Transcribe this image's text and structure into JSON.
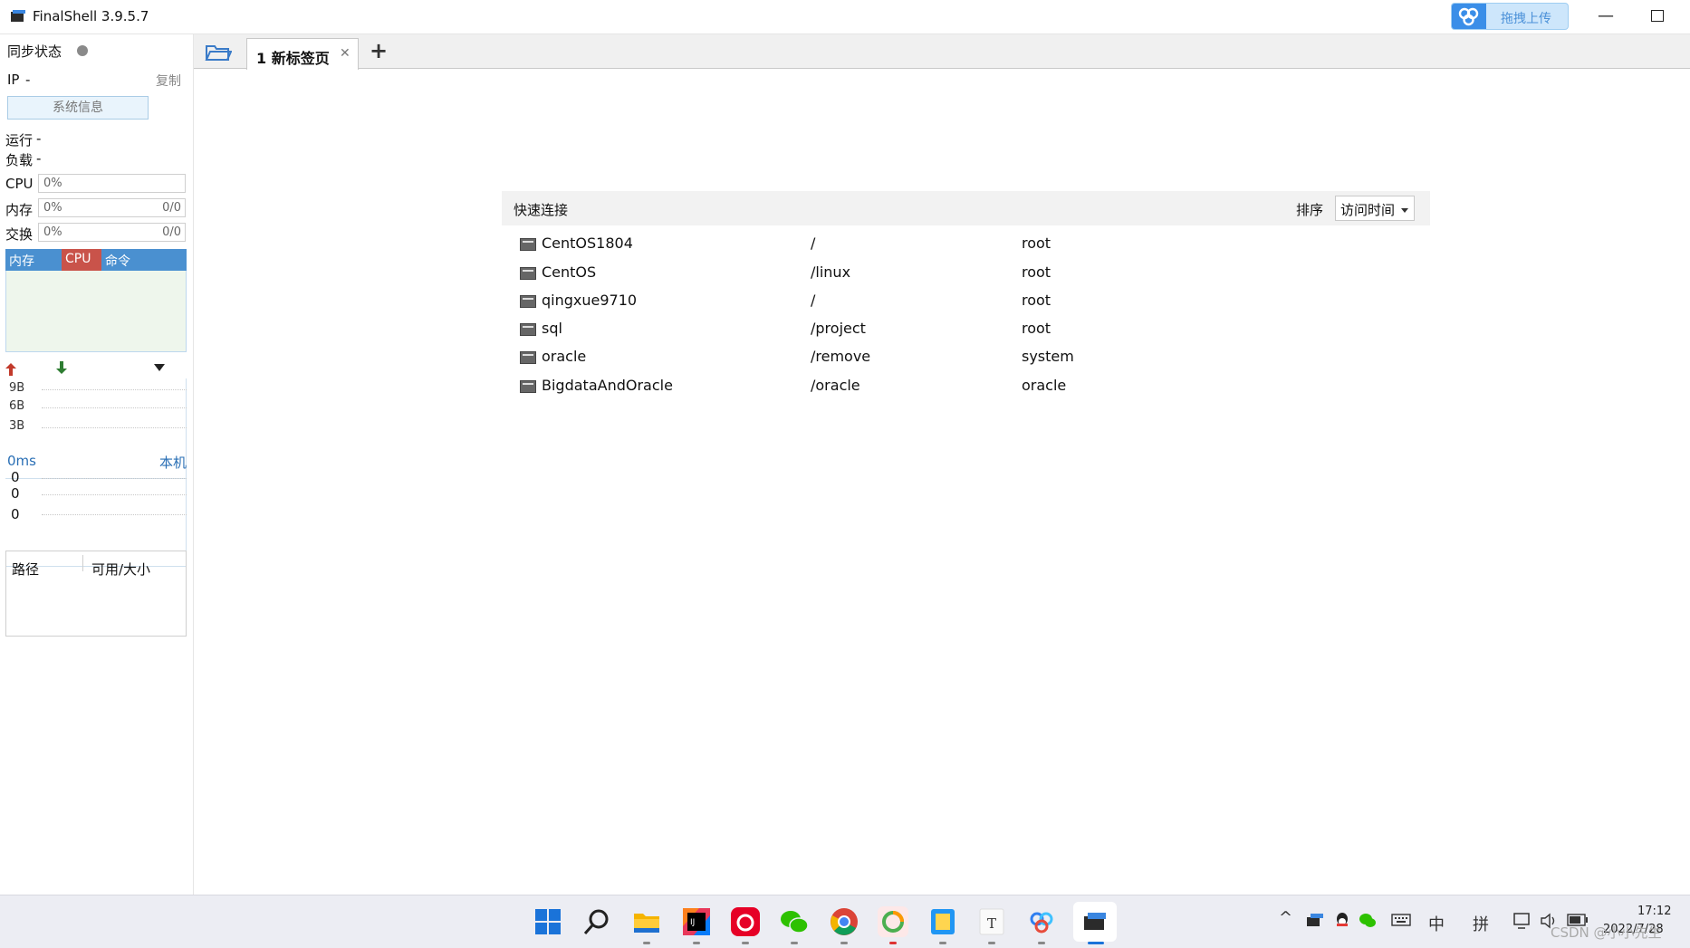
{
  "window": {
    "title": "FinalShell 3.9.5.7",
    "upload_label": "拖拽上传"
  },
  "sidebar": {
    "sync_label": "同步状态",
    "ip_label": "IP",
    "ip_value": "-",
    "copy_label": "复制",
    "sysinfo_label": "系统信息",
    "run_label": "运行",
    "run_value": "-",
    "load_label": "负载",
    "load_value": "-",
    "meters": [
      {
        "label": "CPU",
        "pct": "0%",
        "ratio": ""
      },
      {
        "label": "内存",
        "pct": "0%",
        "ratio": "0/0"
      },
      {
        "label": "交换",
        "pct": "0%",
        "ratio": "0/0"
      }
    ],
    "chart_tabs": [
      "内存",
      "CPU",
      "命令"
    ],
    "net_ticks": [
      "9B",
      "6B",
      "3B"
    ],
    "ping_label": "0ms",
    "ping_host": "本机",
    "ping_ticks": [
      "0",
      "0",
      "0"
    ],
    "disk_headers": [
      "路径",
      "可用/大小"
    ]
  },
  "tabs": [
    {
      "label": "1 新标签页"
    }
  ],
  "quick_connect": {
    "title": "快速连接",
    "sort_label": "排序",
    "sort_value": "访问时间",
    "connections": [
      {
        "name": "CentOS1804",
        "path": "/",
        "user": "root"
      },
      {
        "name": "CentOS",
        "path": "/linux",
        "user": "root"
      },
      {
        "name": "qingxue9710",
        "path": "/",
        "user": "root"
      },
      {
        "name": "sql",
        "path": "/project",
        "user": "root"
      },
      {
        "name": "oracle",
        "path": "/remove",
        "user": "system"
      },
      {
        "name": "BigdataAndOracle",
        "path": "/oracle",
        "user": "oracle"
      }
    ]
  },
  "taskbar": {
    "apps": [
      "windows-start",
      "search",
      "file-explorer",
      "intellij-idea",
      "netease-music",
      "wechat",
      "chrome",
      "app-ring",
      "app-notes",
      "typora",
      "baidu-netdisk",
      "finalshell"
    ],
    "tray": {
      "ime_lang": "中",
      "ime_mode": "拼",
      "time": "17:12",
      "date": "2022/7/28"
    },
    "watermark": "CSDN @小小先生"
  }
}
